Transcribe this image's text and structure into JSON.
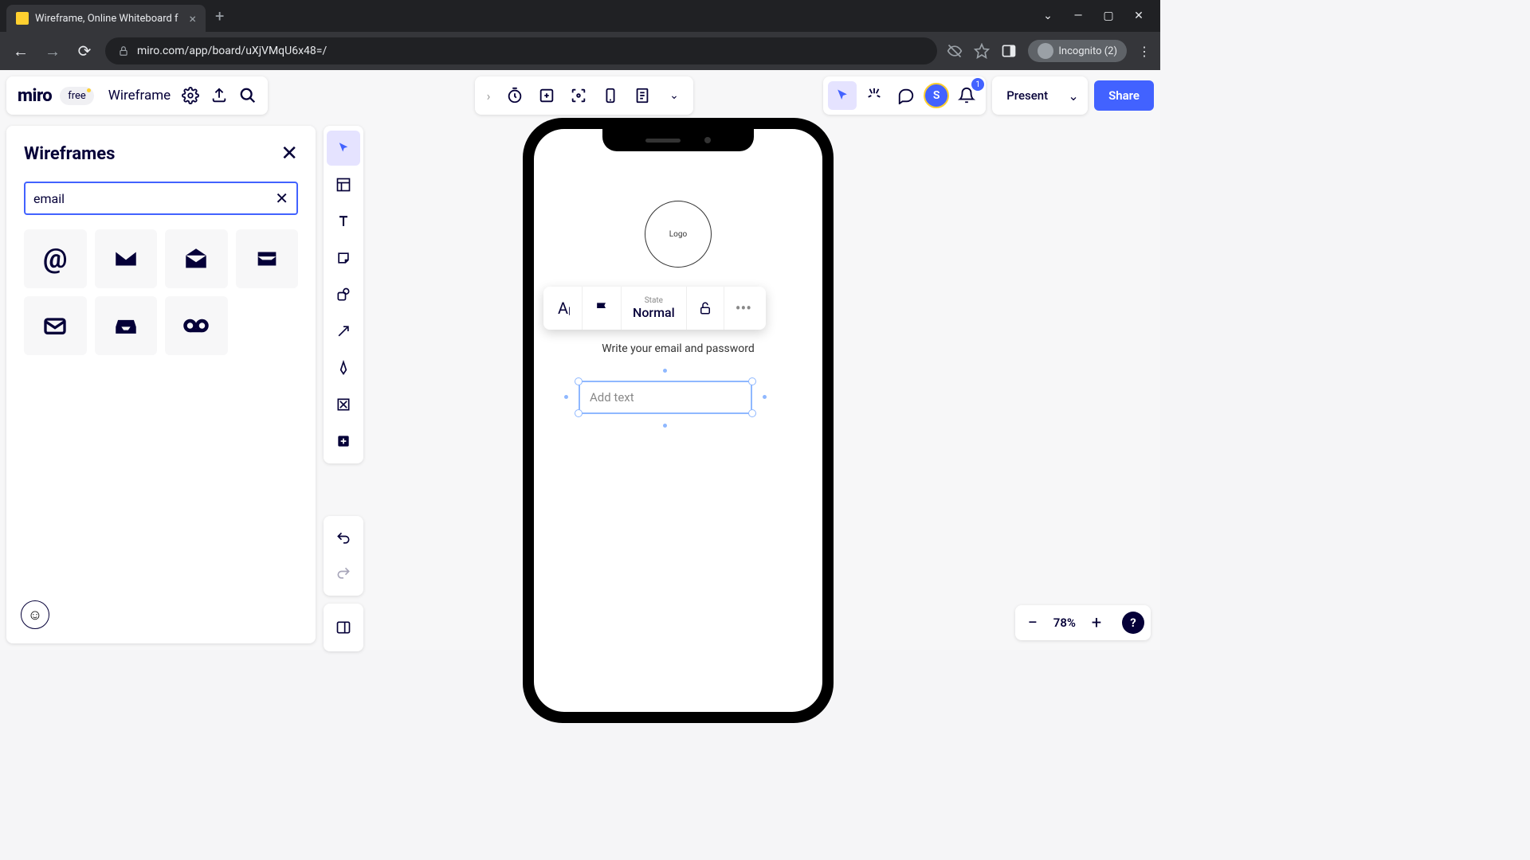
{
  "browser": {
    "tab_title": "Wireframe, Online Whiteboard f",
    "url": "miro.com/app/board/uXjVMqU6x48=/",
    "incognito_label": "Incognito (2)"
  },
  "header": {
    "logo": "miro",
    "plan_badge": "free",
    "board_name": "Wireframe"
  },
  "right_bar": {
    "avatar_initial": "S",
    "notification_count": "1",
    "present_label": "Present",
    "share_label": "Share"
  },
  "wireframes_panel": {
    "title": "Wireframes",
    "search_value": "email",
    "icons": [
      "at-sign",
      "envelope-solid",
      "envelope-open",
      "inbox-badge",
      "envelope-outline",
      "inbox-tray",
      "voicemail"
    ]
  },
  "context_toolbar": {
    "state_label": "State",
    "state_value": "Normal"
  },
  "phone": {
    "logo_text": "Logo",
    "subtitle": "Write your email and password",
    "field_placeholder": "Add text"
  },
  "zoom": {
    "value": "78%"
  }
}
